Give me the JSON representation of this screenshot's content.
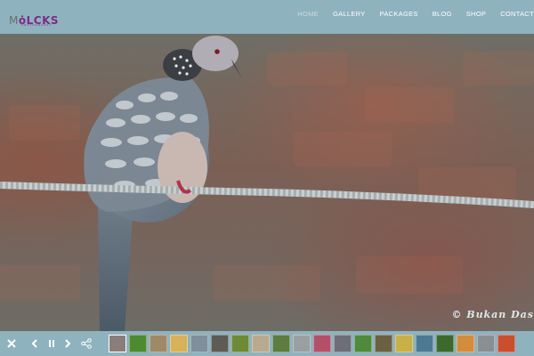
{
  "header": {
    "logo": {
      "prefix": "M",
      "middle": "ȯ",
      "suffix": "LCKS",
      "tagline": "PHOTOGRAPHY"
    },
    "nav": [
      {
        "label": "HOME",
        "active": true
      },
      {
        "label": "GALLERY",
        "active": false
      },
      {
        "label": "PACKAGES",
        "active": false
      },
      {
        "label": "BLOG",
        "active": false
      },
      {
        "label": "SHOP",
        "active": false
      },
      {
        "label": "CONTACT",
        "active": false
      }
    ]
  },
  "photo": {
    "credit": "© Bukan Das"
  },
  "toolbar": {
    "controls": [
      "close-icon",
      "previous-icon",
      "pause-icon",
      "next-icon",
      "share-icon"
    ],
    "thumbnails": [
      {
        "color": "#8a7d7a",
        "active": true
      },
      {
        "color": "#4e8a2f"
      },
      {
        "color": "#9e8a68"
      },
      {
        "color": "#d7b25a"
      },
      {
        "color": "#7f8f9b"
      },
      {
        "color": "#5e5b55"
      },
      {
        "color": "#6f8a36"
      },
      {
        "color": "#b8aa8e"
      },
      {
        "color": "#5d7c3f"
      },
      {
        "color": "#9aa0a2"
      },
      {
        "color": "#b54f68"
      },
      {
        "color": "#6e6f76"
      },
      {
        "color": "#4f8a3d"
      },
      {
        "color": "#6b6042"
      },
      {
        "color": "#c8b046"
      },
      {
        "color": "#4d7a93"
      },
      {
        "color": "#3d6a2c"
      },
      {
        "color": "#d48b3a"
      },
      {
        "color": "#8a8f93"
      },
      {
        "color": "#c94f2f"
      }
    ]
  }
}
